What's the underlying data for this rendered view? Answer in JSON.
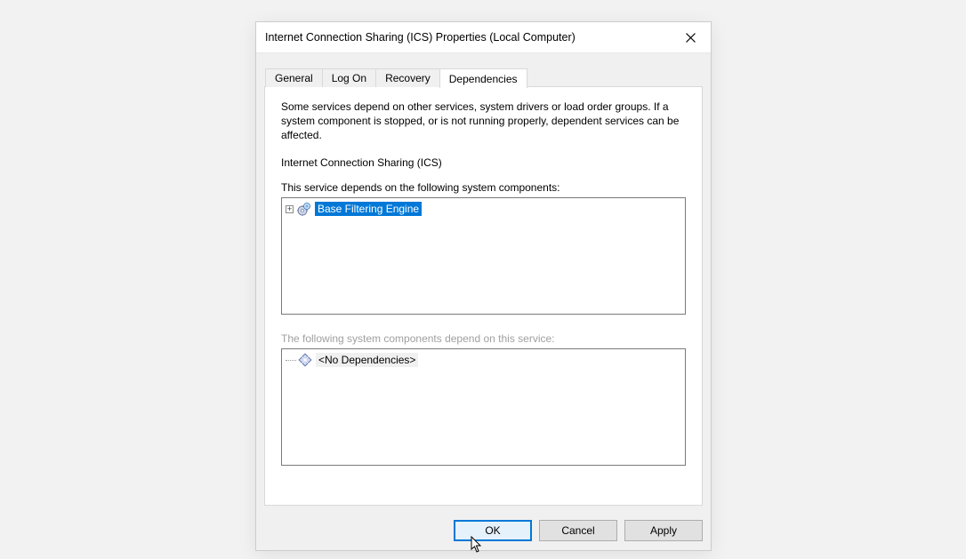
{
  "titlebar": {
    "title": "Internet Connection Sharing (ICS) Properties (Local Computer)"
  },
  "tabs": {
    "general": "General",
    "logon": "Log On",
    "recovery": "Recovery",
    "dependencies": "Dependencies"
  },
  "body": {
    "description": "Some services depend on other services, system drivers or load order groups. If a system component is stopped, or is not running properly, dependent services can be affected.",
    "service_name": "Internet Connection Sharing (ICS)",
    "depends_on_label": "This service depends on the following system components:",
    "depends_on_items": [
      {
        "label": "Base Filtering Engine",
        "expandable": true
      }
    ],
    "dependents_label": "The following system components depend on this service:",
    "dependents_items": [
      {
        "label": "<No Dependencies>"
      }
    ]
  },
  "buttons": {
    "ok": "OK",
    "cancel": "Cancel",
    "apply": "Apply"
  }
}
